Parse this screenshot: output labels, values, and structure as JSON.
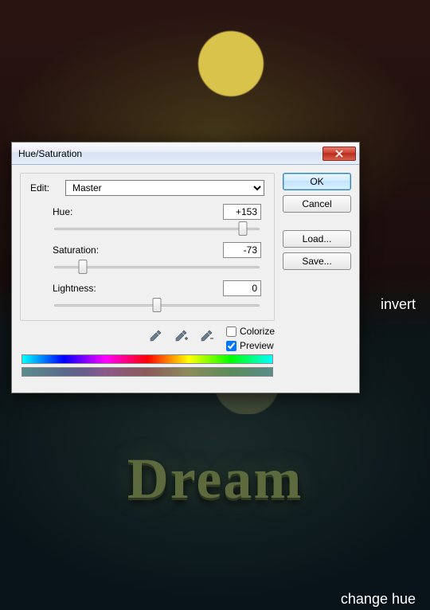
{
  "captions": {
    "invert": "invert",
    "change_hue": "change hue"
  },
  "artwork": {
    "text": "Dream"
  },
  "dialog": {
    "title": "Hue/Saturation",
    "edit_label": "Edit:",
    "edit_value": "Master",
    "sliders": {
      "hue": {
        "label": "Hue:",
        "value": "+153",
        "pos_pct": 92
      },
      "saturation": {
        "label": "Saturation:",
        "value": "-73",
        "pos_pct": 14
      },
      "lightness": {
        "label": "Lightness:",
        "value": "0",
        "pos_pct": 50
      }
    },
    "colorize": {
      "label": "Colorize",
      "checked": false
    },
    "preview": {
      "label": "Preview",
      "checked": true
    },
    "buttons": {
      "ok": "OK",
      "cancel": "Cancel",
      "load": "Load...",
      "save": "Save..."
    }
  }
}
